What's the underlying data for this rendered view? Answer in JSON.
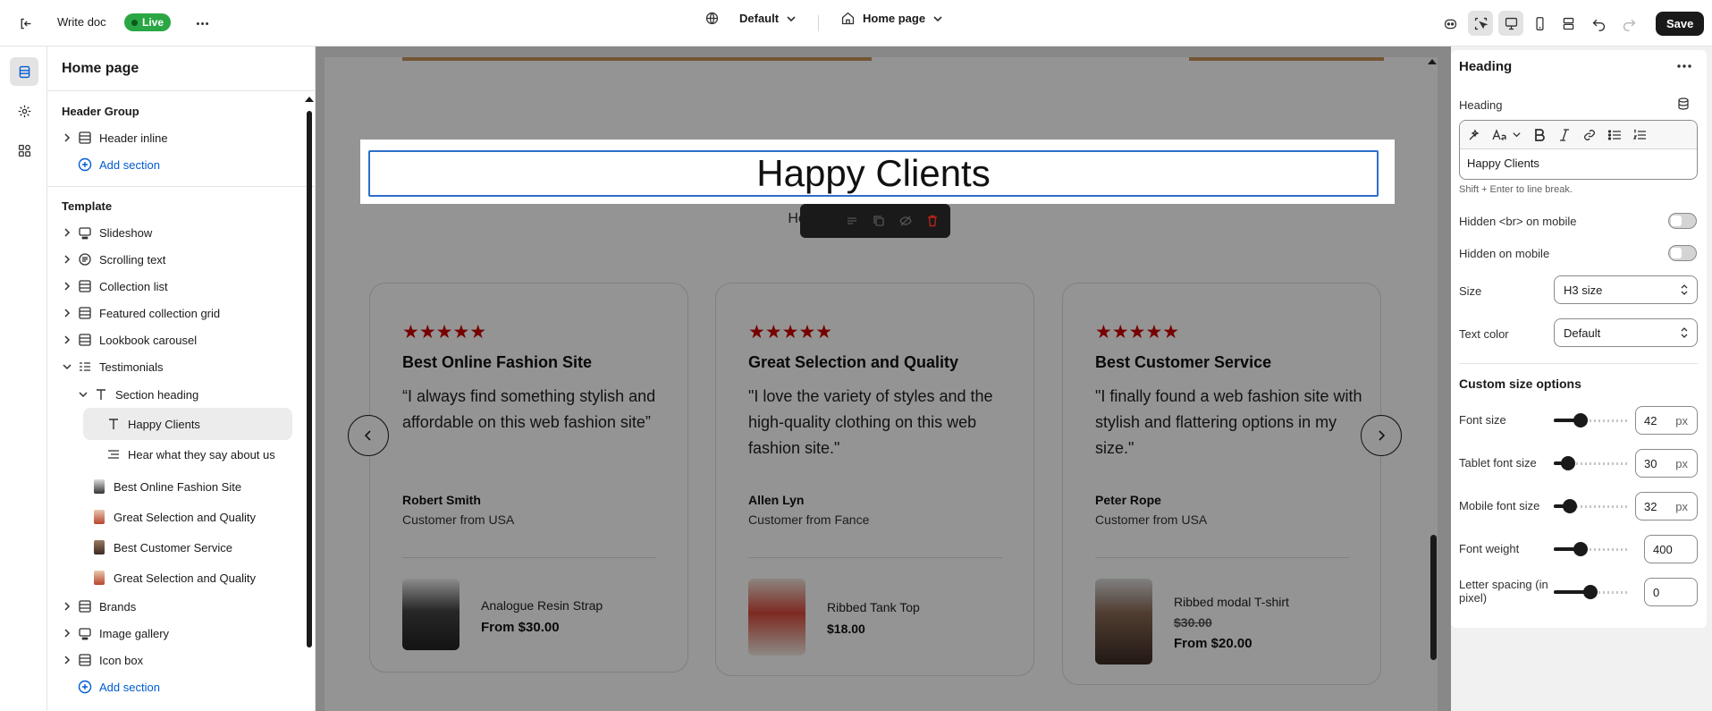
{
  "topbar": {
    "doc_title": "Write doc",
    "live_badge": "Live",
    "theme_selector": "Default",
    "page_selector": "Home page",
    "save_label": "Save"
  },
  "sidebar": {
    "title": "Home page",
    "header_group": {
      "title": "Header Group",
      "items": [
        {
          "label": "Header inline",
          "icon": "section-icon"
        }
      ],
      "add_label": "Add section"
    },
    "template": {
      "title": "Template",
      "items": [
        {
          "label": "Slideshow",
          "icon": "slideshow-icon"
        },
        {
          "label": "Scrolling text",
          "icon": "text-block-icon"
        },
        {
          "label": "Collection list",
          "icon": "section-icon"
        },
        {
          "label": "Featured collection grid",
          "icon": "section-icon"
        },
        {
          "label": "Lookbook carousel",
          "icon": "section-icon"
        },
        {
          "label": "Testimonials",
          "icon": "list-icon"
        }
      ],
      "testimonial_children": {
        "section_heading": "Section heading",
        "heading_items": [
          "Happy Clients",
          "Hear what they say about us"
        ],
        "blocks": [
          "Best Online Fashion Site",
          "Great Selection and Quality",
          "Best Customer Service",
          "Great Selection and Quality"
        ]
      },
      "after_items": [
        {
          "label": "Brands",
          "icon": "section-icon"
        },
        {
          "label": "Image gallery",
          "icon": "slideshow-icon"
        },
        {
          "label": "Icon box",
          "icon": "section-icon"
        }
      ],
      "add_label": "Add section"
    }
  },
  "preview": {
    "heading": "Happy Clients",
    "subheading": "Hear what they say about us",
    "subheading_visible_left": "He",
    "subheading_visible_right": "us",
    "cards": [
      {
        "stars": 5,
        "title": "Best Online Fashion Site",
        "quote": "“I always find something stylish and affordable on this web fashion site”",
        "author": "Robert Smith",
        "origin": "Customer from USA",
        "product": "Analogue Resin Strap",
        "old_price": "",
        "price": "From $30.00"
      },
      {
        "stars": 5,
        "title": "Great Selection and Quality",
        "quote": "\"I love the variety of styles and the high-quality clothing on this web fashion site.\"",
        "author": "Allen Lyn",
        "origin": "Customer from Fance",
        "product": "Ribbed Tank Top",
        "old_price": "",
        "price": "$18.00"
      },
      {
        "stars": 5,
        "title": "Best Customer Service",
        "quote": "\"I finally found a web fashion site with stylish and flattering options in my size.\"",
        "author": "Peter Rope",
        "origin": "Customer from USA",
        "product": "Ribbed modal T-shirt",
        "old_price": "$30.00",
        "price": "From $20.00"
      }
    ]
  },
  "panel": {
    "title": "Heading",
    "heading_label": "Heading",
    "heading_value": "Happy Clients",
    "hint": "Shift + Enter to line break.",
    "hidden_br_label": "Hidden <br> on mobile",
    "hidden_br_on": false,
    "hidden_mobile_label": "Hidden on mobile",
    "hidden_mobile_on": false,
    "size_label": "Size",
    "size_value": "H3 size",
    "text_color_label": "Text color",
    "text_color_value": "Default",
    "custom_title": "Custom size options",
    "sliders": [
      {
        "label": "Font size",
        "value": "42",
        "unit": "px",
        "fraction": 0.37
      },
      {
        "label": "Tablet font size",
        "value": "30",
        "unit": "px",
        "fraction": 0.2
      },
      {
        "label": "Mobile font size",
        "value": "32",
        "unit": "px",
        "fraction": 0.22
      },
      {
        "label": "Font weight",
        "value": "400",
        "unit": "",
        "fraction": 0.37
      },
      {
        "label": "Letter spacing (in pixel)",
        "value": "0",
        "unit": "",
        "fraction": 0.5
      }
    ]
  },
  "colors": {
    "live": "#29a744",
    "accent": "#005bd3",
    "stars": "#cc0000",
    "selection": "#2c6ecb"
  }
}
